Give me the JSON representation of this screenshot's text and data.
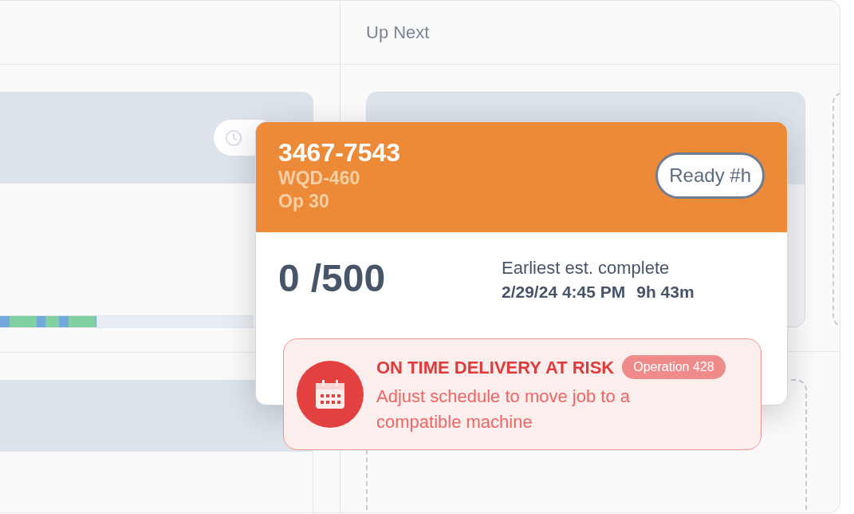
{
  "board": {
    "columns": [
      {
        "title": "Up Next"
      }
    ]
  },
  "left_job": {
    "progress_bar": {
      "level": 0.38
    }
  },
  "job_card": {
    "job_number": "3467-7543",
    "part": "WQD-460",
    "operation": "Op 30",
    "status": "Ready #h",
    "quantity_done": "0",
    "quantity_total": "/500",
    "estimate_label": "Earliest est. complete",
    "estimate_date": "2/29/24 4:45 PM",
    "estimate_duration": "9h 43m"
  },
  "alert": {
    "title": "ON TIME DELIVERY AT RISK",
    "tag": "Operation 428",
    "message": "Adjust schedule to move job to a compatible machine"
  }
}
